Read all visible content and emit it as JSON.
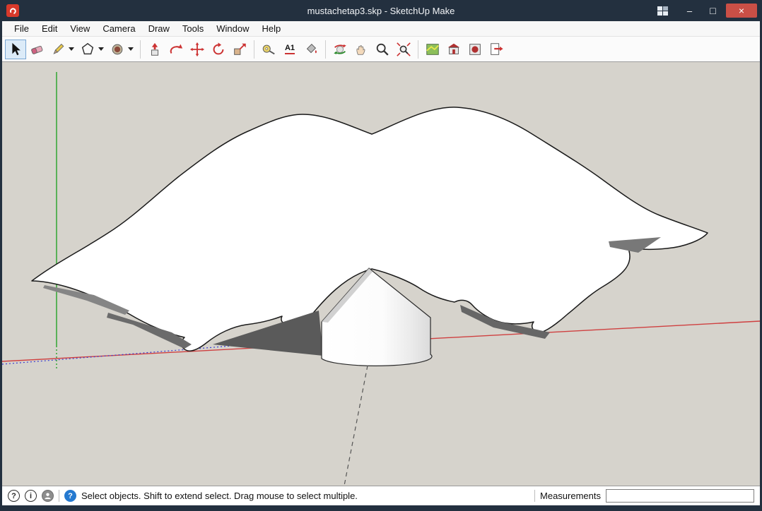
{
  "titlebar": {
    "title": "mustachetap3.skp - SketchUp Make",
    "minimize_glyph": "–",
    "maximize_glyph": "□",
    "close_glyph": "×"
  },
  "menubar": {
    "items": [
      "File",
      "Edit",
      "View",
      "Camera",
      "Draw",
      "Tools",
      "Window",
      "Help"
    ]
  },
  "toolbar": {
    "active_tool": "select",
    "text_tool_label": "A1",
    "tools": [
      "select",
      "eraser",
      "line",
      "shapes",
      "circle",
      "push-pull",
      "follow-me",
      "move",
      "rotate",
      "scale",
      "tape-measure",
      "text",
      "paint-bucket",
      "orbit",
      "pan",
      "zoom",
      "zoom-extents",
      "add-location",
      "3d-warehouse",
      "extension-warehouse",
      "send-to-layout"
    ]
  },
  "viewport": {
    "background_color": "#d6d3cc",
    "axis_colors": {
      "green": "#27a327",
      "red": "#cf4040",
      "blue": "#3b3bd0"
    }
  },
  "statusbar": {
    "help_glyph": "?",
    "info_glyph": "i",
    "instructor_glyph": "?",
    "hint": "Select objects. Shift to extend select. Drag mouse to select multiple.",
    "measurements_label": "Measurements",
    "measurements_value": ""
  }
}
